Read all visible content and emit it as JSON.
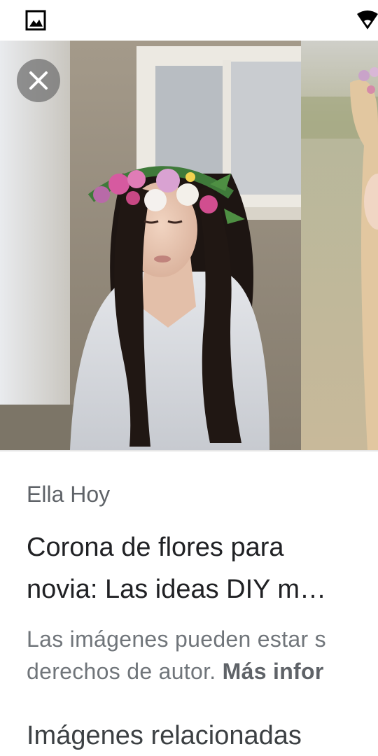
{
  "status_bar": {
    "left_icon": "image-icon",
    "right_icon": "wifi-icon"
  },
  "viewer": {
    "close_icon": "close-icon",
    "image_description_icon": "photo"
  },
  "result": {
    "source": "Ella Hoy",
    "title_line1": "Corona de flores para",
    "title_line2": "novia: Las ideas DIY m…"
  },
  "copyright": {
    "line1": "Las imágenes pueden estar s",
    "line2_prefix": "derechos de autor. ",
    "more_info": "Más infor"
  },
  "related": {
    "heading": "Imágenes relacionadas"
  },
  "colors": {
    "accent_text": "#202124",
    "secondary_text": "#5f6368"
  }
}
